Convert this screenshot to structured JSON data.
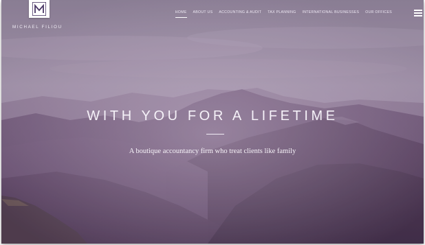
{
  "brand": {
    "logo_letter": "M",
    "name": "MICHAEL FILIOU"
  },
  "nav": {
    "items": [
      {
        "label": "HOME",
        "active": true
      },
      {
        "label": "ABOUT US",
        "active": false
      },
      {
        "label": "ACCOUNTING & AUDIT",
        "active": false
      },
      {
        "label": "TAX PLANNING",
        "active": false
      },
      {
        "label": "INTERNATIONAL BUSINESSES",
        "active": false
      },
      {
        "label": "OUR OFFICES",
        "active": false
      }
    ],
    "menu_icon": "hamburger-menu-icon"
  },
  "hero": {
    "headline": "WITH YOU FOR A LIFETIME",
    "subtitle": "A boutique accountancy firm who treat clients like family",
    "background": "misty purple mountain landscape"
  },
  "colors": {
    "logo_purple": "#4a3766",
    "sky_top": "#8d8296",
    "mountain_dark": "#3f2d45"
  }
}
